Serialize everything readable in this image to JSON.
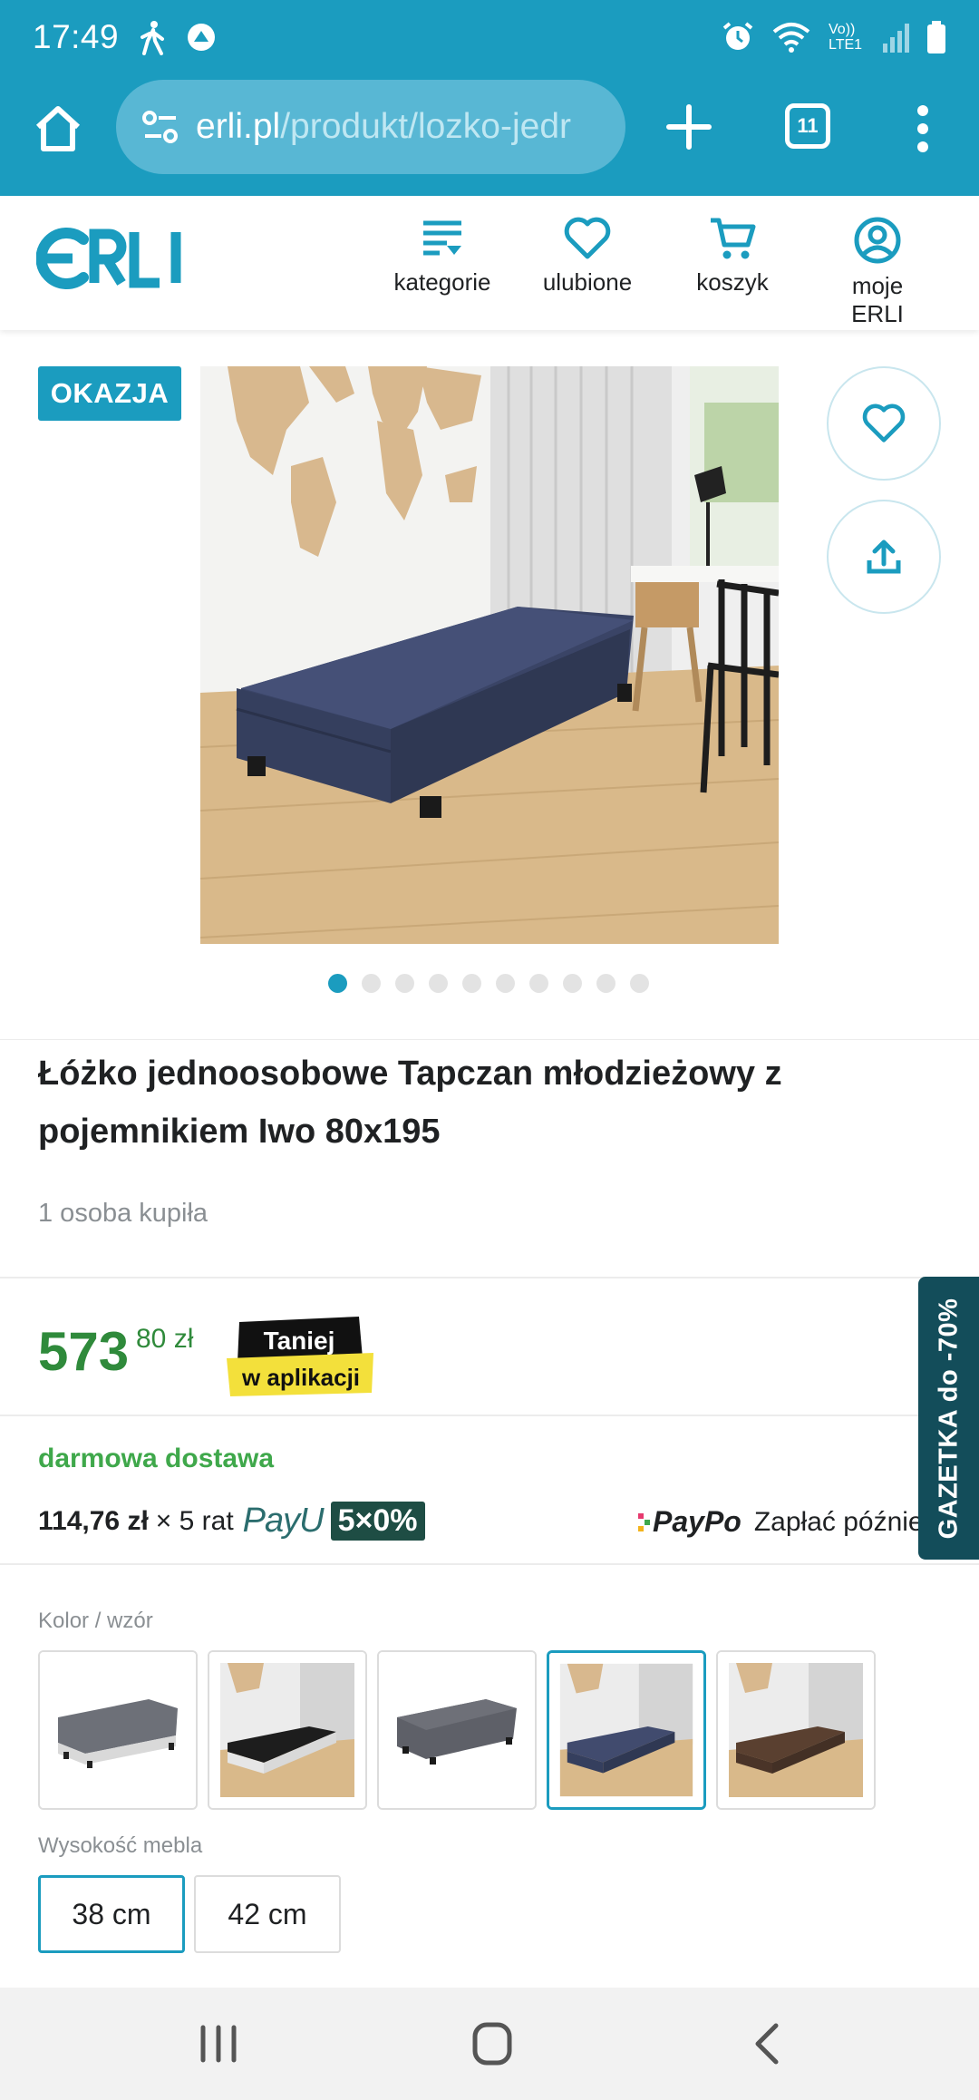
{
  "status_bar": {
    "time": "17:49",
    "network": "Vo)) LTE1",
    "wifi_label": "6"
  },
  "browser": {
    "url_host": "erli.pl",
    "url_path": "/produkt/lozko-jedr",
    "tab_count": "11"
  },
  "site": {
    "logo": "ERLI",
    "nav": [
      {
        "label": "kategorie",
        "icon": "categories-icon"
      },
      {
        "label": "ulubione",
        "icon": "heart-icon"
      },
      {
        "label": "koszyk",
        "icon": "cart-icon"
      },
      {
        "label": "moje ERLI",
        "icon": "user-icon"
      }
    ]
  },
  "gallery": {
    "badge": "OKAZJA",
    "dot_count": 10,
    "active_dot": 0
  },
  "product": {
    "title": "Łóżko jednoosobowe Tapczan młodzieżowy z pojemnikiem Iwo 80x195",
    "bought": "1 osoba kupiła"
  },
  "price": {
    "main": "573",
    "fraction": "80 zł",
    "app_badge_line1": "Taniej",
    "app_badge_line2": "w aplikacji"
  },
  "delivery": {
    "free": "darmowa dostawa"
  },
  "installments": {
    "amount": "114,76 zł",
    "times": "× 5 rat",
    "payu": "PayU",
    "zero_badge": "5×0%",
    "paypo_brand": "PayPo",
    "paypo_text": "Zapłać później"
  },
  "promo_tab": "GAZETKA do -70%",
  "color_section": {
    "label": "Kolor / wzór",
    "selected_index": 3,
    "swatches": [
      "szary jasny",
      "czarny",
      "szary",
      "granatowy",
      "brązowy"
    ]
  },
  "height_section": {
    "label": "Wysokość mebla",
    "options": [
      "38 cm",
      "42 cm"
    ],
    "selected_index": 0
  },
  "colors": {
    "brand": "#1b9cbf",
    "price_green": "#2f8a3b",
    "delivery_green": "#3fa84b",
    "promo_dark": "#134d5a"
  }
}
